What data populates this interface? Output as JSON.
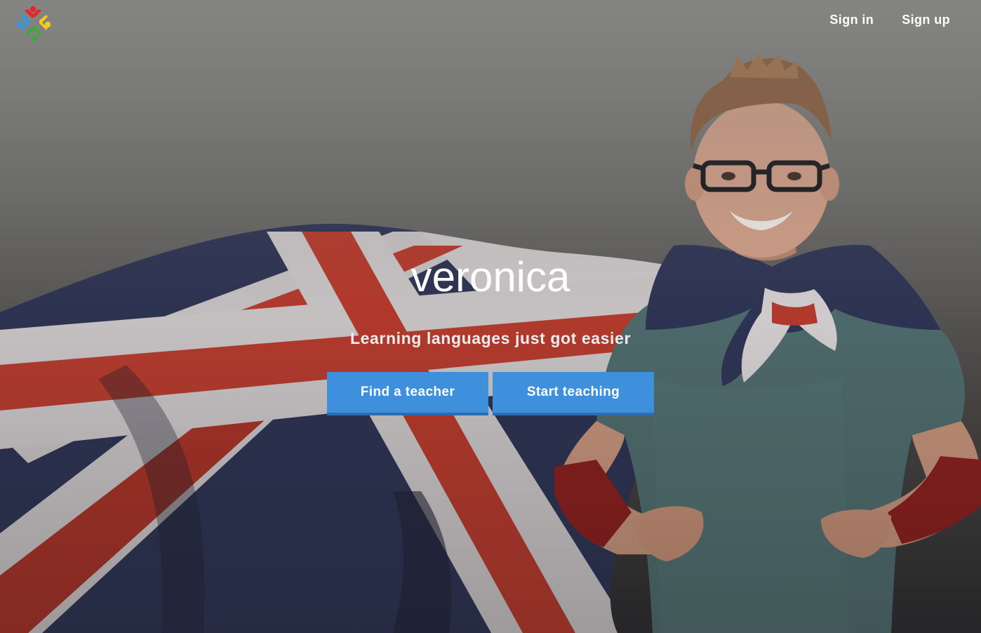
{
  "header": {
    "logo_label": "veronica logo",
    "nav": {
      "sign_in": "Sign in",
      "sign_up": "Sign up"
    }
  },
  "hero": {
    "brand": "veronica",
    "tagline": "Learning languages just got easier",
    "buttons": {
      "find_teacher": "Find a teacher",
      "start_teaching": "Start teaching"
    },
    "image_description": "boy with glasses wearing a Union Jack flag as a cape"
  },
  "colors": {
    "primary_button": "#3f90dc",
    "primary_button_border": "#2a6db1",
    "logo_red": "#e3262c",
    "logo_blue": "#2f9ae0",
    "logo_yellow": "#f5cb1b",
    "logo_green": "#3ea83e"
  }
}
